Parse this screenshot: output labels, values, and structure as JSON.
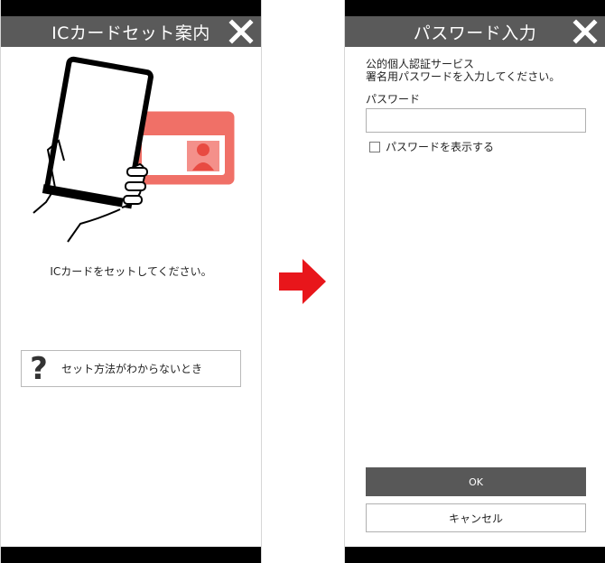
{
  "left_screen": {
    "title": "ICカードセット案内",
    "close_icon": "close-icon",
    "illustration": "phone-on-ic-card",
    "instruction": "ICカードをセットしてください。",
    "help_link": {
      "icon": "question-mark-icon",
      "icon_glyph": "?",
      "label": "セット方法がわからないとき"
    }
  },
  "transition_arrow": {
    "icon": "right-arrow-icon",
    "color": "#e8161b"
  },
  "right_screen": {
    "title": "パスワード入力",
    "close_icon": "close-icon",
    "description_line1": "公的個人認証サービス",
    "description_line2": "署名用パスワードを入力してください。",
    "password_label": "パスワード",
    "password_value": "",
    "show_password_label": "パスワードを表示する",
    "show_password_checked": false,
    "ok_label": "OK",
    "cancel_label": "キャンセル"
  },
  "colors": {
    "titlebar": "#5a5a5a",
    "status_bar": "#000000",
    "card": "#f07067",
    "ok_button": "#585858"
  }
}
